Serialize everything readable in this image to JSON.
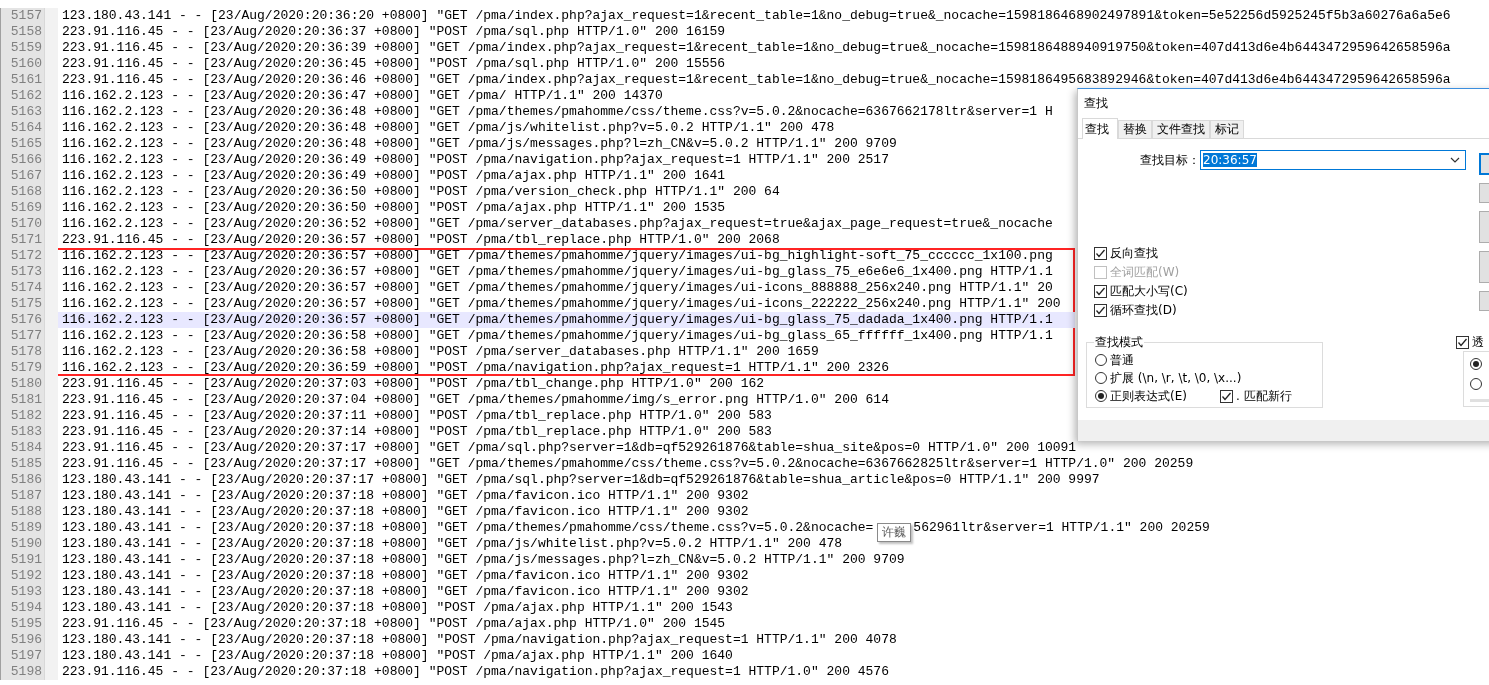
{
  "editor": {
    "lines": [
      {
        "number": "5157",
        "text": "123.180.43.141 - - [23/Aug/2020:20:36:20 +0800] \"GET /pma/index.php?ajax_request=1&recent_table=1&no_debug=true&_nocache=1598186468902497891&token=5e52256d5925245f5b3a60276a6a5e6",
        "boxed": false,
        "current": false
      },
      {
        "number": "5158",
        "text": "223.91.116.45 - - [23/Aug/2020:20:36:37 +0800] \"POST /pma/sql.php HTTP/1.0\" 200 16159",
        "boxed": false,
        "current": false
      },
      {
        "number": "5159",
        "text": "223.91.116.45 - - [23/Aug/2020:20:36:39 +0800] \"GET /pma/index.php?ajax_request=1&recent_table=1&no_debug=true&_nocache=1598186488940919750&token=407d413d6e4b6443472959642658596a",
        "boxed": false,
        "current": false
      },
      {
        "number": "5160",
        "text": "223.91.116.45 - - [23/Aug/2020:20:36:45 +0800] \"POST /pma/sql.php HTTP/1.0\" 200 15556",
        "boxed": false,
        "current": false
      },
      {
        "number": "5161",
        "text": "223.91.116.45 - - [23/Aug/2020:20:36:46 +0800] \"GET /pma/index.php?ajax_request=1&recent_table=1&no_debug=true&_nocache=1598186495683892946&token=407d413d6e4b6443472959642658596a",
        "boxed": false,
        "current": false
      },
      {
        "number": "5162",
        "text": "116.162.2.123 - - [23/Aug/2020:20:36:47 +0800] \"GET /pma/ HTTP/1.1\" 200 14370",
        "boxed": false,
        "current": false
      },
      {
        "number": "5163",
        "text": "116.162.2.123 - - [23/Aug/2020:20:36:48 +0800] \"GET /pma/themes/pmahomme/css/theme.css?v=5.0.2&nocache=6367662178ltr&server=1 H",
        "boxed": false,
        "current": false
      },
      {
        "number": "5164",
        "text": "116.162.2.123 - - [23/Aug/2020:20:36:48 +0800] \"GET /pma/js/whitelist.php?v=5.0.2 HTTP/1.1\" 200 478",
        "boxed": false,
        "current": false
      },
      {
        "number": "5165",
        "text": "116.162.2.123 - - [23/Aug/2020:20:36:48 +0800] \"GET /pma/js/messages.php?l=zh_CN&v=5.0.2 HTTP/1.1\" 200 9709",
        "boxed": false,
        "current": false
      },
      {
        "number": "5166",
        "text": "116.162.2.123 - - [23/Aug/2020:20:36:49 +0800] \"POST /pma/navigation.php?ajax_request=1 HTTP/1.1\" 200 2517",
        "boxed": false,
        "current": false
      },
      {
        "number": "5167",
        "text": "116.162.2.123 - - [23/Aug/2020:20:36:49 +0800] \"POST /pma/ajax.php HTTP/1.1\" 200 1641",
        "boxed": false,
        "current": false
      },
      {
        "number": "5168",
        "text": "116.162.2.123 - - [23/Aug/2020:20:36:50 +0800] \"POST /pma/version_check.php HTTP/1.1\" 200 64",
        "boxed": false,
        "current": false
      },
      {
        "number": "5169",
        "text": "116.162.2.123 - - [23/Aug/2020:20:36:50 +0800] \"POST /pma/ajax.php HTTP/1.1\" 200 1535",
        "boxed": false,
        "current": false
      },
      {
        "number": "5170",
        "text": "116.162.2.123 - - [23/Aug/2020:20:36:52 +0800] \"GET /pma/server_databases.php?ajax_request=true&ajax_page_request=true&_nocache",
        "boxed": false,
        "current": false
      },
      {
        "number": "5171",
        "text": "223.91.116.45 - - [23/Aug/2020:20:36:57 +0800] \"POST /pma/tbl_replace.php HTTP/1.0\" 200 2068",
        "boxed": false,
        "current": false
      },
      {
        "number": "5172",
        "text": "116.162.2.123 - - [23/Aug/2020:20:36:57 +0800] \"GET /pma/themes/pmahomme/jquery/images/ui-bg_highlight-soft_75_cccccc_1x100.png",
        "boxed": true,
        "current": false
      },
      {
        "number": "5173",
        "text": "116.162.2.123 - - [23/Aug/2020:20:36:57 +0800] \"GET /pma/themes/pmahomme/jquery/images/ui-bg_glass_75_e6e6e6_1x400.png HTTP/1.1",
        "boxed": true,
        "current": false
      },
      {
        "number": "5174",
        "text": "116.162.2.123 - - [23/Aug/2020:20:36:57 +0800] \"GET /pma/themes/pmahomme/jquery/images/ui-icons_888888_256x240.png HTTP/1.1\" 20",
        "boxed": true,
        "current": false
      },
      {
        "number": "5175",
        "text": "116.162.2.123 - - [23/Aug/2020:20:36:57 +0800] \"GET /pma/themes/pmahomme/jquery/images/ui-icons_222222_256x240.png HTTP/1.1\" 200",
        "boxed": true,
        "current": false
      },
      {
        "number": "5176",
        "text": "116.162.2.123 - - [23/Aug/2020:20:36:57 +0800] \"GET /pma/themes/pmahomme/jquery/images/ui-bg_glass_75_dadada_1x400.png HTTP/1.1",
        "boxed": true,
        "current": true
      },
      {
        "number": "5177",
        "text": "116.162.2.123 - - [23/Aug/2020:20:36:58 +0800] \"GET /pma/themes/pmahomme/jquery/images/ui-bg_glass_65_ffffff_1x400.png HTTP/1.1",
        "boxed": true,
        "current": false
      },
      {
        "number": "5178",
        "text": "116.162.2.123 - - [23/Aug/2020:20:36:58 +0800] \"POST /pma/server_databases.php HTTP/1.1\" 200 1659",
        "boxed": true,
        "current": false
      },
      {
        "number": "5179",
        "text": "116.162.2.123 - - [23/Aug/2020:20:36:59 +0800] \"POST /pma/navigation.php?ajax_request=1 HTTP/1.1\" 200 2326",
        "boxed": true,
        "current": false
      },
      {
        "number": "5180",
        "text": "223.91.116.45 - - [23/Aug/2020:20:37:03 +0800] \"POST /pma/tbl_change.php HTTP/1.0\" 200 162",
        "boxed": false,
        "current": false
      },
      {
        "number": "5181",
        "text": "223.91.116.45 - - [23/Aug/2020:20:37:04 +0800] \"GET /pma/themes/pmahomme/img/s_error.png HTTP/1.0\" 200 614",
        "boxed": false,
        "current": false
      },
      {
        "number": "5182",
        "text": "223.91.116.45 - - [23/Aug/2020:20:37:11 +0800] \"POST /pma/tbl_replace.php HTTP/1.0\" 200 583",
        "boxed": false,
        "current": false
      },
      {
        "number": "5183",
        "text": "223.91.116.45 - - [23/Aug/2020:20:37:14 +0800] \"POST /pma/tbl_replace.php HTTP/1.0\" 200 583",
        "boxed": false,
        "current": false
      },
      {
        "number": "5184",
        "text": "223.91.116.45 - - [23/Aug/2020:20:37:17 +0800] \"GET /pma/sql.php?server=1&db=qf529261876&table=shua_site&pos=0 HTTP/1.0\" 200 10091",
        "boxed": false,
        "current": false
      },
      {
        "number": "5185",
        "text": "223.91.116.45 - - [23/Aug/2020:20:37:17 +0800] \"GET /pma/themes/pmahomme/css/theme.css?v=5.0.2&nocache=6367662825ltr&server=1 HTTP/1.0\" 200 20259",
        "boxed": false,
        "current": false
      },
      {
        "number": "5186",
        "text": "123.180.43.141 - - [23/Aug/2020:20:37:17 +0800] \"GET /pma/sql.php?server=1&db=qf529261876&table=shua_article&pos=0 HTTP/1.1\" 200 9997",
        "boxed": false,
        "current": false
      },
      {
        "number": "5187",
        "text": "123.180.43.141 - - [23/Aug/2020:20:37:18 +0800] \"GET /pma/favicon.ico HTTP/1.1\" 200 9302",
        "boxed": false,
        "current": false
      },
      {
        "number": "5188",
        "text": "123.180.43.141 - - [23/Aug/2020:20:37:18 +0800] \"GET /pma/favicon.ico HTTP/1.1\" 200 9302",
        "boxed": false,
        "current": false
      },
      {
        "number": "5189",
        "text": "123.180.43.141 - - [23/Aug/2020:20:37:18 +0800] \"GET /pma/themes/pmahomme/css/theme.css?v=5.0.2&nocache=",
        "tooltip": "许巍",
        "text_after": "562961ltr&server=1 HTTP/1.1\" 200 20259",
        "boxed": false,
        "current": false
      },
      {
        "number": "5190",
        "text": "123.180.43.141 - - [23/Aug/2020:20:37:18 +0800] \"GET /pma/js/whitelist.php?v=5.0.2 HTTP/1.1\" 200 478",
        "boxed": false,
        "current": false
      },
      {
        "number": "5191",
        "text": "123.180.43.141 - - [23/Aug/2020:20:37:18 +0800] \"GET /pma/js/messages.php?l=zh_CN&v=5.0.2 HTTP/1.1\" 200 9709",
        "boxed": false,
        "current": false
      },
      {
        "number": "5192",
        "text": "123.180.43.141 - - [23/Aug/2020:20:37:18 +0800] \"GET /pma/favicon.ico HTTP/1.1\" 200 9302",
        "boxed": false,
        "current": false
      },
      {
        "number": "5193",
        "text": "123.180.43.141 - - [23/Aug/2020:20:37:18 +0800] \"GET /pma/favicon.ico HTTP/1.1\" 200 9302",
        "boxed": false,
        "current": false
      },
      {
        "number": "5194",
        "text": "123.180.43.141 - - [23/Aug/2020:20:37:18 +0800] \"POST /pma/ajax.php HTTP/1.1\" 200 1543",
        "boxed": false,
        "current": false
      },
      {
        "number": "5195",
        "text": "223.91.116.45 - - [23/Aug/2020:20:37:18 +0800] \"POST /pma/ajax.php HTTP/1.0\" 200 1545",
        "boxed": false,
        "current": false
      },
      {
        "number": "5196",
        "text": "123.180.43.141 - - [23/Aug/2020:20:37:18 +0800] \"POST /pma/navigation.php?ajax_request=1 HTTP/1.1\" 200 4078",
        "boxed": false,
        "current": false
      },
      {
        "number": "5197",
        "text": "123.180.43.141 - - [23/Aug/2020:20:37:18 +0800] \"POST /pma/ajax.php HTTP/1.1\" 200 1640",
        "boxed": false,
        "current": false
      },
      {
        "number": "5198",
        "text": "223.91.116.45 - - [23/Aug/2020:20:37:18 +0800] \"POST /pma/navigation.php?ajax_request=1 HTTP/1.0\" 200 4576",
        "boxed": false,
        "current": false
      }
    ]
  },
  "find_dialog": {
    "title": "查找",
    "tabs": [
      {
        "label": "查找",
        "selected": true
      },
      {
        "label": "替换",
        "selected": false
      },
      {
        "label": "文件查找",
        "selected": false
      },
      {
        "label": "标记",
        "selected": false
      }
    ],
    "search_label": "查找目标：",
    "search_value": "20:36:57",
    "search_value_selected": true,
    "side_buttons": [
      {
        "default": true
      },
      {
        "default": false
      },
      {
        "default": false
      },
      {
        "default": false
      },
      {
        "default": false
      }
    ],
    "options": [
      {
        "label": "反向查找",
        "checked": true,
        "disabled": false
      },
      {
        "label": "全词匹配(W)",
        "checked": false,
        "disabled": true
      },
      {
        "label": "匹配大小写(C)",
        "checked": true,
        "disabled": false
      },
      {
        "label": "循环查找(D)",
        "checked": true,
        "disabled": false
      }
    ],
    "mode_group": {
      "title": "查找模式",
      "options": [
        {
          "label": "普通",
          "selected": false
        },
        {
          "label": "扩展 (\\n, \\r, \\t, \\0, \\x...)",
          "selected": false
        },
        {
          "label": "正则表达式(E)",
          "selected": true
        }
      ],
      "newline_option": {
        "label": ". 匹配新行",
        "checked": true
      }
    },
    "transparency": {
      "label": "透",
      "checked": true,
      "options": [
        {
          "selected": true
        },
        {
          "selected": false
        }
      ]
    }
  }
}
